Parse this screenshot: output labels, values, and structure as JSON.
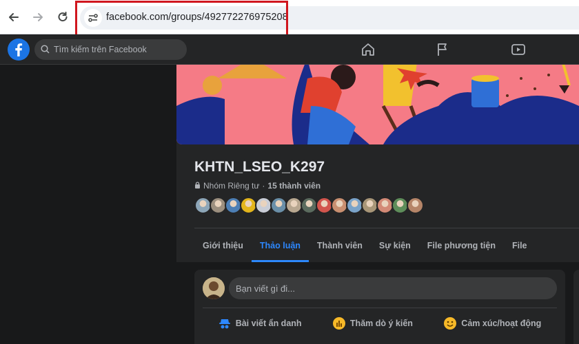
{
  "browser": {
    "url": "facebook.com/groups/492772276975208",
    "icons": [
      "back-arrow-icon",
      "forward-arrow-icon",
      "reload-icon",
      "site-settings-icon"
    ],
    "highlight_color": "#d0161e"
  },
  "topbar": {
    "search_placeholder": "Tìm kiếm trên Facebook",
    "nav_icons": [
      "home-icon",
      "pages-flag-icon",
      "video-icon"
    ],
    "brand_color": "#1b74e4"
  },
  "group": {
    "name": "KHTN_LSEO_K297",
    "privacy": "Nhóm Riêng tư",
    "separator": "·",
    "members": "15 thành viên",
    "member_avatar_colors": [
      "#8da6b8",
      "#9c8f7f",
      "#4d7fb5",
      "#e3b51c",
      "#c9cdd6",
      "#6a8fa8",
      "#b8a790",
      "#5b6b5e",
      "#d2554d",
      "#c98f70",
      "#7aa3c9",
      "#a89678",
      "#d38a76",
      "#5e8d5a",
      "#b58568"
    ]
  },
  "tabs": [
    {
      "label": "Giới thiệu",
      "active": false
    },
    {
      "label": "Thảo luận",
      "active": true
    },
    {
      "label": "Thành viên",
      "active": false
    },
    {
      "label": "Sự kiện",
      "active": false
    },
    {
      "label": "File phương tiện",
      "active": false
    },
    {
      "label": "File",
      "active": false
    }
  ],
  "composer": {
    "placeholder": "Bạn viết gì đi...",
    "actions": [
      {
        "label": "Bài viết ẩn danh",
        "icon": "anonymous-post-icon",
        "color": "#2d88ff"
      },
      {
        "label": "Thăm dò ý kiến",
        "icon": "poll-icon",
        "color": "#f7b928"
      },
      {
        "label": "Cảm xúc/hoạt động",
        "icon": "feeling-smiley-icon",
        "color": "#f7b928"
      }
    ]
  },
  "colors": {
    "accent": "#2d88ff",
    "cover_background": "#f57b86",
    "cover_navy": "#1b2c8a"
  }
}
